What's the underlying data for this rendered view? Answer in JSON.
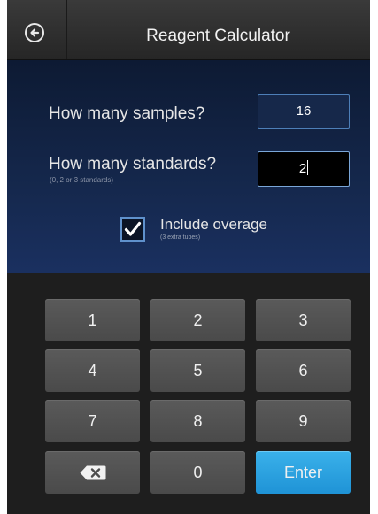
{
  "header": {
    "title": "Reagent Calculator"
  },
  "form": {
    "samples_label": "How many samples?",
    "samples_value": "16",
    "standards_label": "How many standards?",
    "standards_hint": "(0, 2 or 3 standards)",
    "standards_value": "2",
    "overage_label": "Include overage",
    "overage_hint": "(3 extra tubes)",
    "overage_checked": true
  },
  "keypad": {
    "keys": [
      "1",
      "2",
      "3",
      "4",
      "5",
      "6",
      "7",
      "8",
      "9"
    ],
    "zero": "0",
    "enter": "Enter"
  },
  "colors": {
    "accent": "#2aa3e2",
    "panel": "#15284d",
    "keypad_bg": "#1e1e1e"
  }
}
